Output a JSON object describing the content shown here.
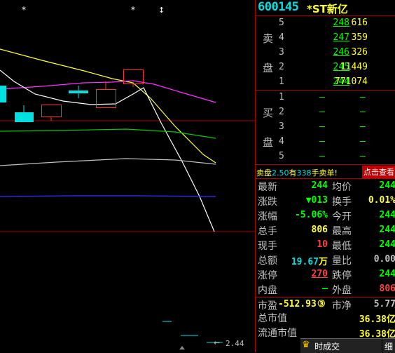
{
  "stock": {
    "code": "600145",
    "name": "*ST新亿"
  },
  "chart": {
    "markers": [
      "*",
      "*",
      "↕"
    ],
    "last_price_label": "2.44",
    "colors": {
      "ma5": "#ffffff",
      "ma10": "#ffff33",
      "ma20": "#ff33ff",
      "ma_green": "#00cc00",
      "ma_white": "#c0c0c0",
      "ma_blue": "#3333ff",
      "rise": "#ff3333",
      "fall": "#00e0e0"
    }
  },
  "order_book": {
    "sell_label_top": "卖",
    "sell_label_bottom": "盘",
    "buy_label_top": "买",
    "buy_label_bottom": "盘",
    "sell": [
      {
        "level": "5",
        "price": "248",
        "volume": "616"
      },
      {
        "level": "4",
        "price": "247",
        "volume": "359"
      },
      {
        "level": "3",
        "price": "246",
        "volume": "326"
      },
      {
        "level": "2",
        "price": "245",
        "volume": "11449"
      },
      {
        "level": "1",
        "price": "244",
        "volume": "771074"
      }
    ],
    "buy": [
      {
        "level": "1",
        "price": "–",
        "volume": "–"
      },
      {
        "level": "2",
        "price": "–",
        "volume": "–"
      },
      {
        "level": "3",
        "price": "–",
        "volume": "–"
      },
      {
        "level": "4",
        "price": "–",
        "volume": "–"
      },
      {
        "level": "5",
        "price": "–",
        "volume": "–"
      }
    ]
  },
  "notice": {
    "prefix": "卖盘",
    "price": "2.50",
    "middle": "有",
    "qty": "338",
    "suffix": "手卖单!",
    "button": "点击查看"
  },
  "quotes": {
    "latest_label": "最新",
    "latest": "244",
    "avg_label": "均价",
    "avg": "244",
    "change_label": "涨跌",
    "change": "▼013",
    "turnover_label": "换手",
    "turnover": "0.01%",
    "pct_label": "涨幅",
    "pct": "-5.06%",
    "open_label": "今开",
    "open": "244",
    "total_hands_label": "总手",
    "total_hands": "806",
    "high_label": "最高",
    "high": "244",
    "current_hands_label": "现手",
    "current_hands": "10",
    "low_label": "最低",
    "low": "244",
    "amount_label": "总额",
    "amount": "19.67",
    "amount_unit": "万",
    "vol_ratio_label": "量比",
    "vol_ratio": "0.00",
    "limit_up_label": "涨停",
    "limit_up": "270",
    "limit_down_label": "跌停",
    "limit_down": "244",
    "inner_label": "内盘",
    "inner": "–",
    "outer_label": "外盘",
    "outer": "806",
    "pe_label": "市盈",
    "pe": "-512.93",
    "pe_badge": "③",
    "pb_label": "市净",
    "pb": "5.77",
    "total_mv_label": "总市值",
    "total_mv": "36.38",
    "total_mv_unit": "亿",
    "float_mv_label": "流通市值",
    "float_mv": "36.38",
    "float_mv_unit": "亿"
  },
  "tabs": {
    "realtime": "时成交",
    "detail": "细"
  }
}
